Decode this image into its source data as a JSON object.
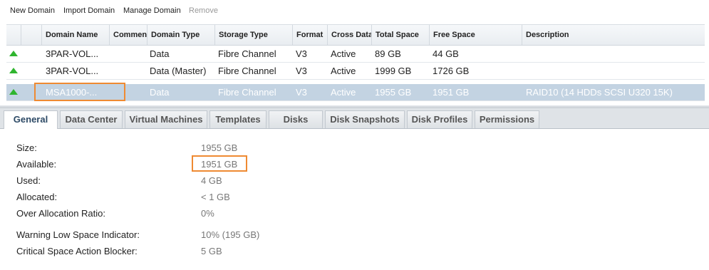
{
  "toolbar": {
    "new_domain": "New Domain",
    "import_domain": "Import Domain",
    "manage_domain": "Manage Domain",
    "remove": "Remove"
  },
  "table": {
    "headers": [
      "",
      "",
      "Domain Name",
      "Comment",
      "Domain Type",
      "Storage Type",
      "Format",
      "Cross Data",
      "Total Space",
      "Free Space",
      "Description"
    ],
    "rows": [
      {
        "status": "up-arrow-icon",
        "domain_name": "3PAR-VOL...",
        "comment": "",
        "domain_type": "Data",
        "storage_type": "Fibre Channel",
        "format": "V3",
        "cross_data": "Active",
        "total_space": "89 GB",
        "free_space": "44 GB",
        "description": ""
      },
      {
        "status": "up-arrow-icon",
        "domain_name": "3PAR-VOL...",
        "comment": "",
        "domain_type": "Data (Master)",
        "storage_type": "Fibre Channel",
        "format": "V3",
        "cross_data": "Active",
        "total_space": "1999 GB",
        "free_space": "1726 GB",
        "description": ""
      },
      {
        "status": "up-arrow-icon",
        "domain_name": "MSA1000-...",
        "comment": "",
        "domain_type": "Data",
        "storage_type": "Fibre Channel",
        "format": "V3",
        "cross_data": "Active",
        "total_space": "1955 GB",
        "free_space": "1951 GB",
        "description": "RAID10 (14 HDDs SCSI U320 15K)",
        "selected": true
      }
    ]
  },
  "tabs": [
    "General",
    "Data Center",
    "Virtual Machines",
    "Templates",
    "Disks",
    "Disk Snapshots",
    "Disk Profiles",
    "Permissions"
  ],
  "active_tab": "General",
  "general": {
    "size_label": "Size:",
    "size_value": "1955 GB",
    "available_label": "Available:",
    "available_value": "1951 GB",
    "used_label": "Used:",
    "used_value": "4 GB",
    "allocated_label": "Allocated:",
    "allocated_value": "< 1 GB",
    "over_allocation_label": "Over Allocation Ratio:",
    "over_allocation_value": "0%",
    "warning_label": "Warning Low Space Indicator:",
    "warning_value": "10% (195 GB)",
    "critical_label": "Critical Space Action Blocker:",
    "critical_value": "5 GB"
  },
  "colors": {
    "status_up": "#2fb52f",
    "selected_row": "#c3d3e2",
    "highlight": "#ef8a32"
  }
}
